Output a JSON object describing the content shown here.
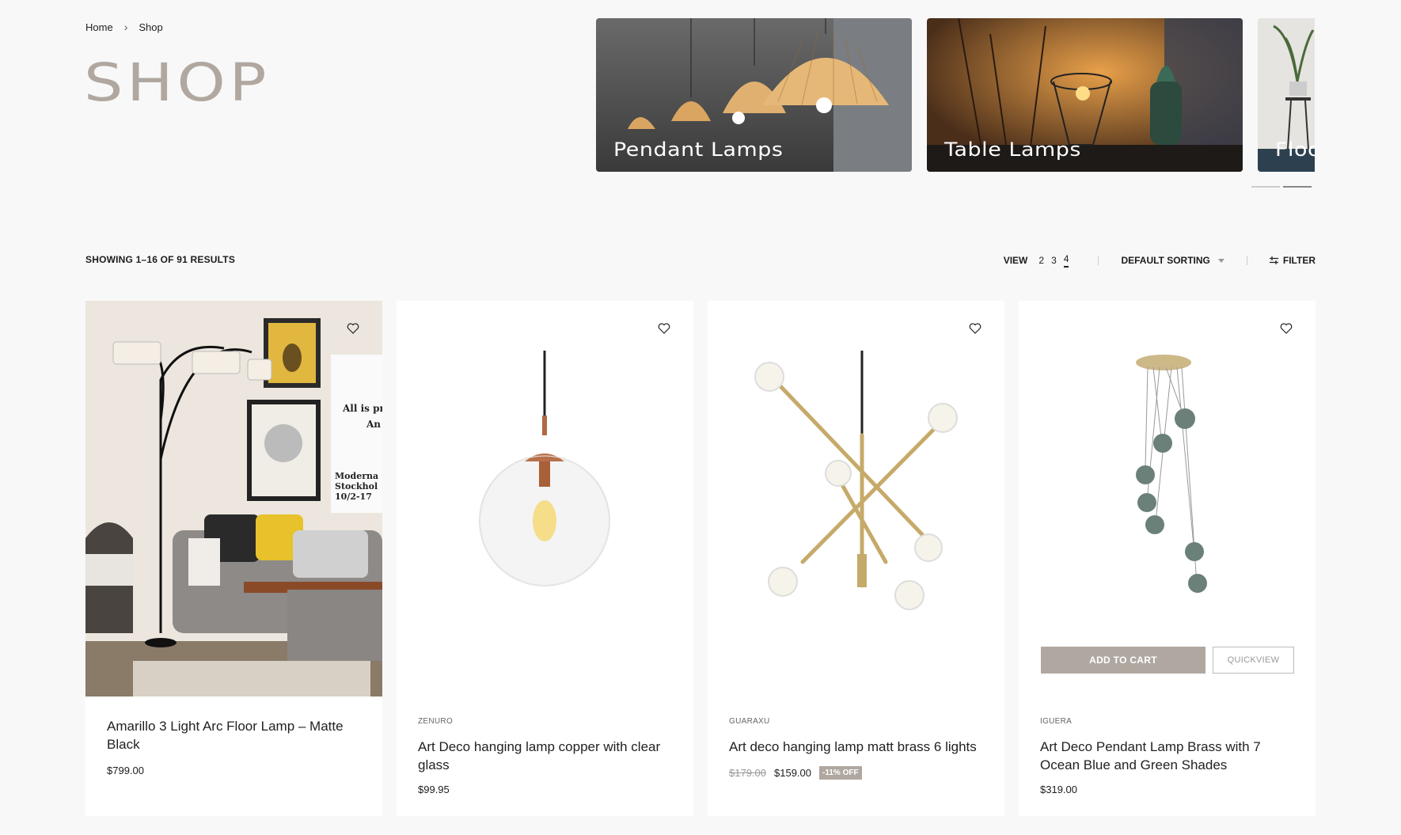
{
  "breadcrumb": {
    "home": "Home",
    "separator": "›",
    "current": "Shop"
  },
  "page_title": "SHOP",
  "categories": [
    {
      "label": "Pendant Lamps"
    },
    {
      "label": "Table Lamps"
    },
    {
      "label": "Floo"
    }
  ],
  "toolbar": {
    "results": "SHOWING 1–16 OF 91 RESULTS",
    "view_label": "VIEW",
    "view_options": [
      "2",
      "3",
      "4"
    ],
    "view_active": "4",
    "sorting": "DEFAULT SORTING",
    "filter": "FILTER"
  },
  "products": [
    {
      "brand": "",
      "name": "Amarillo 3 Light Arc Floor Lamp – Matte Black",
      "price": "$799.00"
    },
    {
      "brand": "ZENURO",
      "name": "Art Deco hanging lamp copper with clear glass",
      "price": "$99.95"
    },
    {
      "brand": "GUARAXU",
      "name": "Art deco hanging lamp matt brass 6 lights",
      "old_price": "$179.00",
      "price": "$159.00",
      "badge": "-11% OFF"
    },
    {
      "brand": "IGUERA",
      "name": "Art Deco Pendant Lamp Brass with 7 Ocean Blue and Green Shades",
      "price": "$319.00"
    }
  ],
  "buttons": {
    "add_to_cart": "ADD TO CART",
    "quickview": "QUICKVIEW"
  },
  "colors": {
    "accent": "#b0a8a0",
    "background": "#f8f8f8"
  }
}
